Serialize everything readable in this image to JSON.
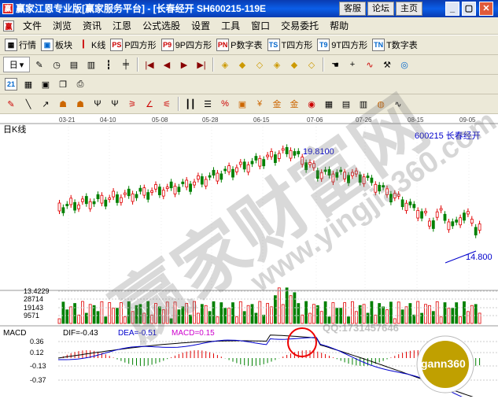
{
  "title": {
    "text": "赢家江恩专业版[赢家服务平台] - [长春经开 SH600215-119E"
  },
  "title_links": [
    "客服",
    "论坛",
    "主页"
  ],
  "window_buttons": [
    "_",
    "▢",
    "✕"
  ],
  "menu": [
    "文件",
    "浏览",
    "资讯",
    "江恩",
    "公式选股",
    "设置",
    "工具",
    "窗口",
    "交易委托",
    "帮助"
  ],
  "toolbar1": [
    {
      "icon": "grid-icon",
      "label": "行情"
    },
    {
      "icon": "blocks-icon",
      "label": "板块"
    },
    {
      "icon": "kline-icon",
      "label": "K线"
    },
    {
      "icon": "p-square-icon",
      "label": "P四方形",
      "badge": "PS"
    },
    {
      "icon": "p9-square-icon",
      "label": "9P四方形",
      "badge": "P9"
    },
    {
      "icon": "p-number-table-icon",
      "label": "P数字表",
      "badge": "PN"
    },
    {
      "icon": "t-square-icon",
      "label": "T四方形",
      "badge": "TS"
    },
    {
      "icon": "t9-square-icon",
      "label": "9T四方形",
      "badge": "T9"
    },
    {
      "icon": "t-number-table-icon",
      "label": "T数字表",
      "badge": "TN"
    }
  ],
  "toolbar2": {
    "period_label": "日"
  },
  "chart": {
    "period_label": "日K线",
    "stock_label": "600215 长春经开",
    "dates": [
      "03-21",
      "04-10",
      "05-08",
      "05-28",
      "06-15",
      "07-06",
      "07-26",
      "08-15",
      "09-05"
    ],
    "high_label": "19.8100",
    "low_label": "14.800",
    "vol_labels": [
      "13.4229",
      "28714",
      "19143",
      "9571"
    ],
    "macd_title": "MACD",
    "dif_label": "DIF=-0.43",
    "dea_label": "DEA=-0.51",
    "macd_label": "MACD=0.15",
    "macd_axis": [
      "0.36",
      "0.12",
      "-0.13",
      "-0.37"
    ],
    "watermark_big": "赢家财富网",
    "watermark_small": "www.yingjia360.com",
    "logo_text": "gann360",
    "phone": "QQ:1731457646"
  },
  "colors": {
    "up": "#e00000",
    "down": "#008000",
    "title": "#0b4fd8",
    "accent": "#0000cc"
  }
}
